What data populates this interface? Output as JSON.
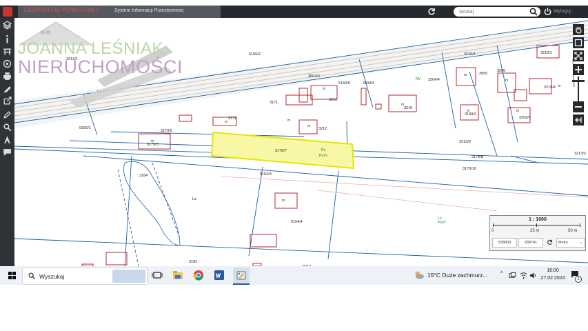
{
  "app": {
    "name": "GEOPORTAL POWIATOWY",
    "subtitle": "System Informacji Przestrzennej"
  },
  "search": {
    "placeholder": "Szukaj"
  },
  "logout": {
    "label": "Wyloguj"
  },
  "watermark": {
    "line1": "JOANNA LEŚNIAK",
    "line2": "NIERUCHOMOŚCI"
  },
  "map": {
    "parcels": [
      "5150/2",
      "3210/1",
      "3219/1",
      "3219/4",
      "3206/1",
      "3204/4",
      "3193/1",
      "3193/3",
      "3193/2",
      "3210",
      "3212",
      "3171",
      "3179/5",
      "3179/3",
      "3179/7",
      "3179/8",
      "3179/10",
      "3213/3",
      "3213/8",
      "3199/2",
      "3209/1",
      "5154/3",
      "5154/4",
      "5155/1",
      "3184",
      "3182",
      "3214",
      "3504/3",
      "5150/6",
      "3505",
      "3506",
      "3211"
    ],
    "landuse": [
      "Ls",
      "Lz",
      "Lz",
      "PsVI",
      "PsVI",
      "RV"
    ],
    "building_label": "m",
    "highlight_label": "PsVI"
  },
  "scale": {
    "ratio": "1 : 1000",
    "ticks": [
      "0",
      "25 m",
      "50 m"
    ],
    "x": "538833",
    "y": "288741",
    "unit": "Metry"
  },
  "taskbar": {
    "search_label": "Wyszukaj",
    "weather": "15°C  Duże zachmurz...",
    "time": "16:00",
    "date": "27.02.2024",
    "notifications": "1"
  },
  "colors": {
    "topbar": "#26292d",
    "highlight": "#f5f58a",
    "parcel_line": "#1a5fa8",
    "building": "#b3262e"
  }
}
